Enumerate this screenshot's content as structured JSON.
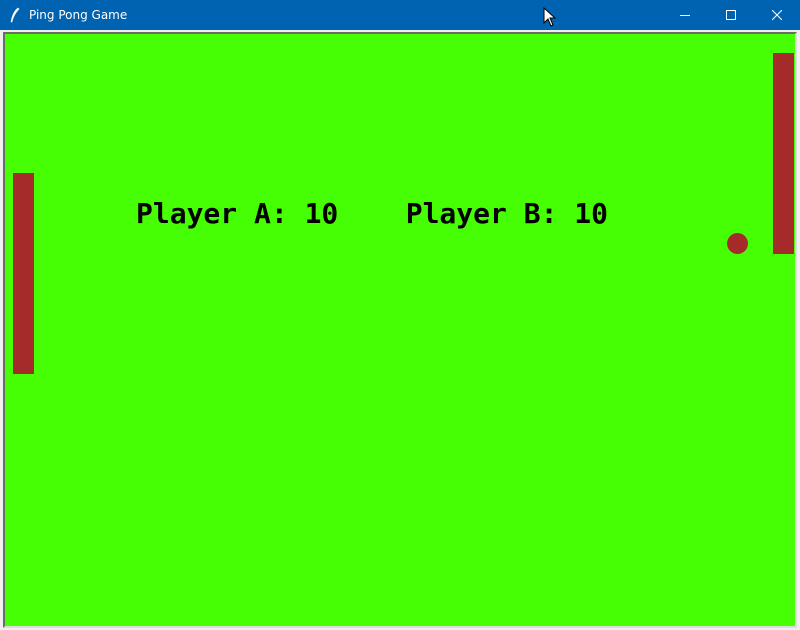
{
  "window": {
    "title": "Ping Pong Game",
    "app_icon": "feather-icon",
    "buttons": {
      "minimize_icon": "minimize-icon",
      "maximize_icon": "maximize-icon",
      "close_icon": "close-icon"
    }
  },
  "game": {
    "background_color": "#47ff04",
    "paddle_color": "#a52a2a",
    "ball_color": "#a52a2a",
    "scoreboard": "Player A: 10    Player B: 10"
  }
}
